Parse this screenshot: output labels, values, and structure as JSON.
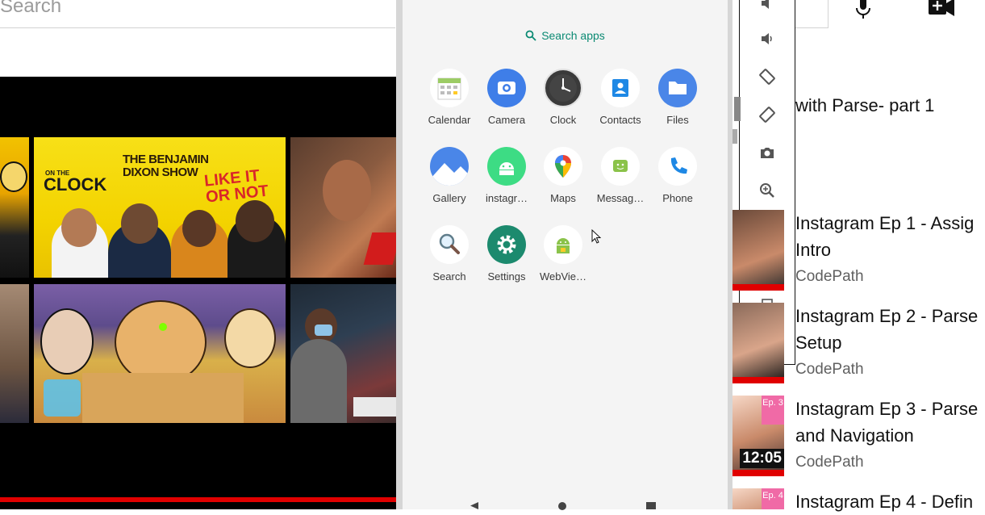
{
  "yt_left": {
    "search_placeholder": "Search",
    "thumbnails": {
      "b_show_title": "THE BENJAMIN DIXON SHOW",
      "b_on_the": "ON THE",
      "b_clock": "CLOCK",
      "b_like_it": "LIKE IT OR NOT"
    }
  },
  "emulator": {
    "search_apps": "Search apps",
    "apps": [
      {
        "label": "Calendar",
        "icon": "calendar-icon"
      },
      {
        "label": "Camera",
        "icon": "camera-icon"
      },
      {
        "label": "Clock",
        "icon": "clock-icon"
      },
      {
        "label": "Contacts",
        "icon": "contacts-icon"
      },
      {
        "label": "Files",
        "icon": "files-icon"
      },
      {
        "label": "Gallery",
        "icon": "gallery-icon"
      },
      {
        "label": "instagr…",
        "icon": "android-icon"
      },
      {
        "label": "Maps",
        "icon": "maps-icon"
      },
      {
        "label": "Messag…",
        "icon": "messages-icon"
      },
      {
        "label": "Phone",
        "icon": "phone-icon"
      },
      {
        "label": "Search",
        "icon": "search-magnifier-icon"
      },
      {
        "label": "Settings",
        "icon": "settings-gear-icon"
      },
      {
        "label": "WebVie…",
        "icon": "webview-android-icon"
      }
    ],
    "colors": {
      "accent": "#0b8a73",
      "camera": "#3f7ee8",
      "files": "#4a86e8",
      "settings": "#1c8a6e",
      "android_green": "#3ddc84"
    }
  },
  "toolbar": {
    "items": [
      "volume-up-icon",
      "volume-down-icon",
      "rotate-left-icon",
      "rotate-right-icon",
      "screenshot-camera-icon",
      "zoom-icon",
      "back-icon",
      "home-icon",
      "overview-icon",
      "more-icon"
    ]
  },
  "yt_right": {
    "video_title": "with Parse- part 1",
    "recommendations": [
      {
        "title_line1": "Instagram Ep 1 - Assig",
        "title_line2": "Intro",
        "channel": "CodePath",
        "duration": ""
      },
      {
        "title_line1": "Instagram Ep 2 - Parse",
        "title_line2": "Setup",
        "channel": "CodePath",
        "duration": ""
      },
      {
        "title_line1": "Instagram Ep 3 - Parse",
        "title_line2": "and Navigation",
        "channel": "CodePath",
        "duration": "12:05",
        "badge": "Ep. 3"
      },
      {
        "title_line1": "Instagram Ep 4 - Defin",
        "title_line2": "",
        "channel": "",
        "duration": "",
        "badge": "Ep. 4"
      }
    ]
  }
}
